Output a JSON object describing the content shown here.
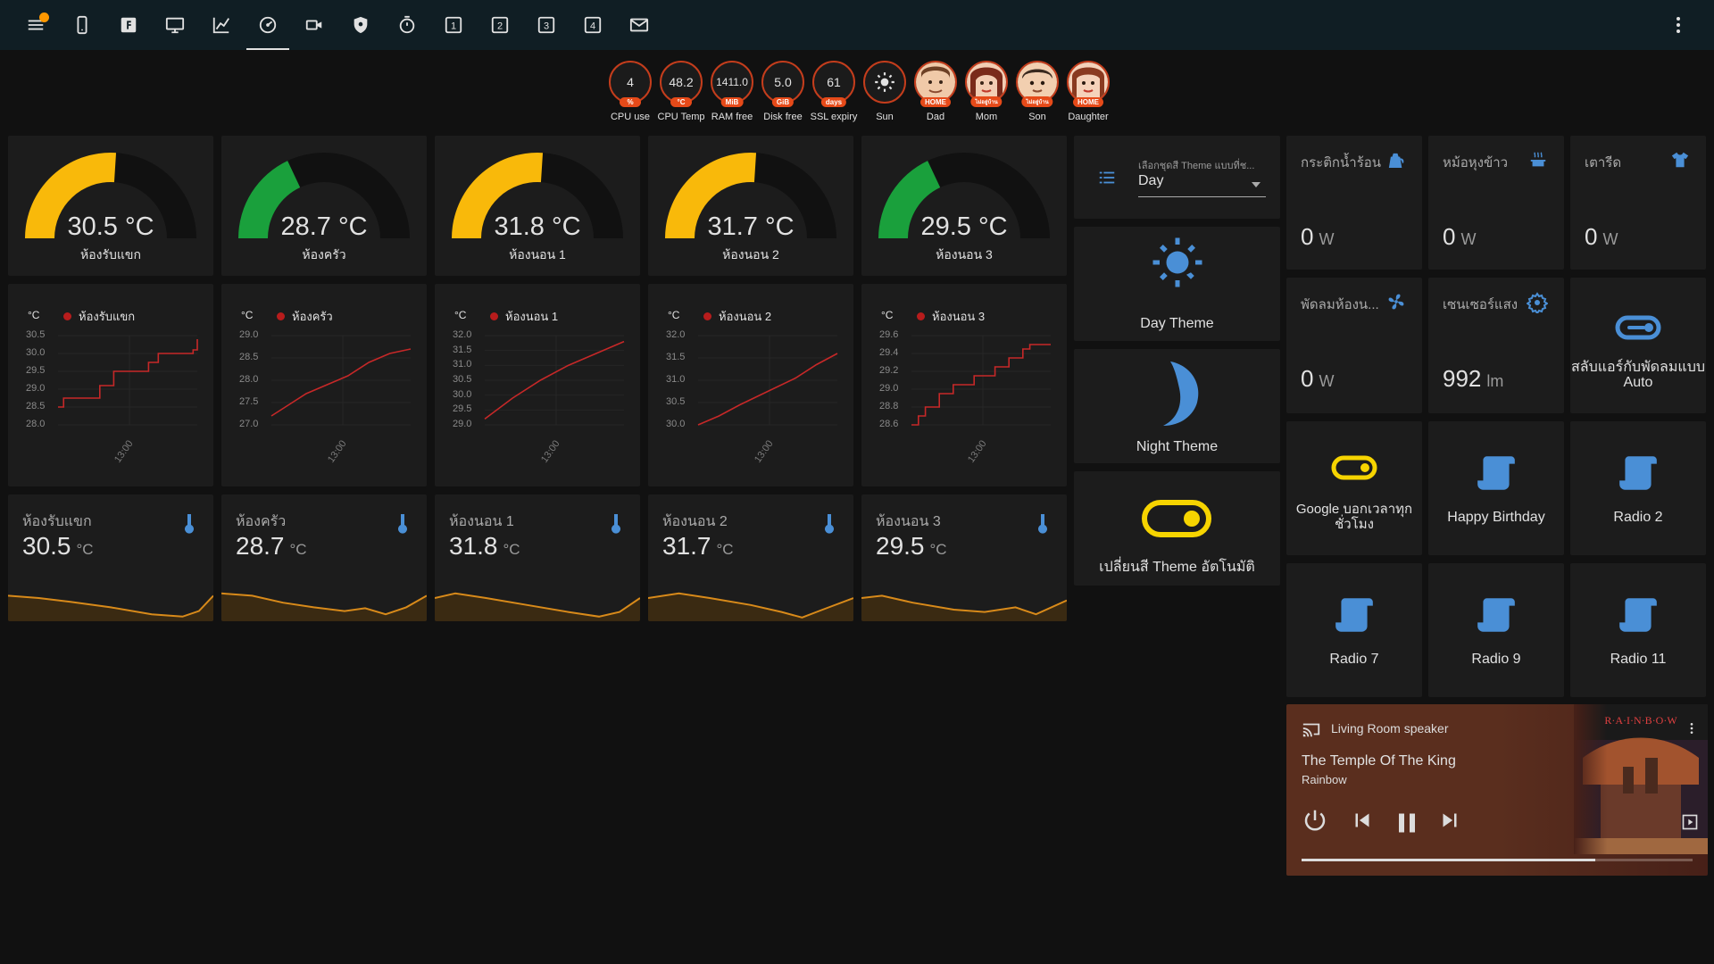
{
  "badges": [
    {
      "value": "4",
      "unit": "%",
      "label": "CPU use"
    },
    {
      "value": "48.2",
      "unit": "°C",
      "label": "CPU Temp"
    },
    {
      "value": "1411.0",
      "unit": "MiB",
      "label": "RAM free"
    },
    {
      "value": "5.0",
      "unit": "GiB",
      "label": "Disk free"
    },
    {
      "value": "61",
      "unit": "days",
      "label": "SSL expiry"
    }
  ],
  "sun": {
    "label": "Sun"
  },
  "people": [
    {
      "status": "HOME",
      "label": "Dad"
    },
    {
      "status": "ไม่อยู่บ้าน",
      "label": "Mom"
    },
    {
      "status": "ไม่อยู่บ้าน",
      "label": "Son"
    },
    {
      "status": "HOME",
      "label": "Daughter"
    }
  ],
  "colors": {
    "gauge_yellow": "#f9b90a",
    "gauge_green": "#1aa03c",
    "history_line": "#c62828",
    "sensor_line": "#d88a1a",
    "icon_blue": "#4a8fd6"
  },
  "gauges": [
    {
      "value": "30.5 °C",
      "name": "ห้องรับแขก",
      "level": 0.52,
      "color": "#f9b90a"
    },
    {
      "value": "28.7 °C",
      "name": "ห้องครัว",
      "level": 0.36,
      "color": "#1aa03c"
    },
    {
      "value": "31.8 °C",
      "name": "ห้องนอน 1",
      "level": 0.52,
      "color": "#f9b90a"
    },
    {
      "value": "31.7 °C",
      "name": "ห้องนอน 2",
      "level": 0.52,
      "color": "#f9b90a"
    },
    {
      "value": "29.5 °C",
      "name": "ห้องนอน 3",
      "level": 0.36,
      "color": "#1aa03c"
    }
  ],
  "history": [
    {
      "unit": "°C",
      "name": "ห้องรับแขก",
      "ticks": [
        "30.5",
        "30.0",
        "29.5",
        "29.0",
        "28.5",
        "28.0"
      ],
      "time": "13:00",
      "min": 28.0,
      "max": 30.5,
      "points": [
        [
          0,
          28.5
        ],
        [
          0.04,
          28.5
        ],
        [
          0.04,
          28.75
        ],
        [
          0.3,
          28.75
        ],
        [
          0.3,
          29.1
        ],
        [
          0.4,
          29.1
        ],
        [
          0.4,
          29.5
        ],
        [
          0.65,
          29.5
        ],
        [
          0.65,
          29.75
        ],
        [
          0.72,
          29.75
        ],
        [
          0.72,
          30.0
        ],
        [
          0.97,
          30.0
        ],
        [
          0.97,
          30.1
        ],
        [
          1.0,
          30.1
        ],
        [
          1.0,
          30.4
        ]
      ]
    },
    {
      "unit": "°C",
      "name": "ห้องครัว",
      "ticks": [
        "29.0",
        "28.5",
        "28.0",
        "27.5",
        "27.0"
      ],
      "time": "13:00",
      "min": 27.0,
      "max": 29.0,
      "points": [
        [
          0,
          27.2
        ],
        [
          0.1,
          27.4
        ],
        [
          0.25,
          27.7
        ],
        [
          0.4,
          27.9
        ],
        [
          0.55,
          28.1
        ],
        [
          0.7,
          28.4
        ],
        [
          0.85,
          28.6
        ],
        [
          1.0,
          28.7
        ]
      ]
    },
    {
      "unit": "°C",
      "name": "ห้องนอน 1",
      "ticks": [
        "32.0",
        "31.5",
        "31.0",
        "30.5",
        "30.0",
        "29.5",
        "29.0"
      ],
      "time": "13:00",
      "min": 29.0,
      "max": 32.0,
      "points": [
        [
          0,
          29.2
        ],
        [
          0.2,
          29.9
        ],
        [
          0.4,
          30.5
        ],
        [
          0.6,
          31.0
        ],
        [
          0.8,
          31.4
        ],
        [
          1.0,
          31.8
        ]
      ]
    },
    {
      "unit": "°C",
      "name": "ห้องนอน 2",
      "ticks": [
        "32.0",
        "31.5",
        "31.0",
        "30.5",
        "30.0"
      ],
      "time": "13:00",
      "min": 30.0,
      "max": 32.0,
      "points": [
        [
          0,
          30.0
        ],
        [
          0.15,
          30.2
        ],
        [
          0.3,
          30.45
        ],
        [
          0.5,
          30.75
        ],
        [
          0.7,
          31.05
        ],
        [
          0.85,
          31.35
        ],
        [
          1.0,
          31.6
        ]
      ]
    },
    {
      "unit": "°C",
      "name": "ห้องนอน 3",
      "ticks": [
        "29.6",
        "29.4",
        "29.2",
        "29.0",
        "28.8",
        "28.6"
      ],
      "time": "13:00",
      "min": 28.6,
      "max": 29.6,
      "points": [
        [
          0,
          28.6
        ],
        [
          0.05,
          28.6
        ],
        [
          0.05,
          28.7
        ],
        [
          0.1,
          28.7
        ],
        [
          0.1,
          28.8
        ],
        [
          0.2,
          28.8
        ],
        [
          0.2,
          28.95
        ],
        [
          0.3,
          28.95
        ],
        [
          0.3,
          29.05
        ],
        [
          0.45,
          29.05
        ],
        [
          0.45,
          29.15
        ],
        [
          0.6,
          29.15
        ],
        [
          0.6,
          29.25
        ],
        [
          0.7,
          29.25
        ],
        [
          0.7,
          29.35
        ],
        [
          0.8,
          29.35
        ],
        [
          0.8,
          29.45
        ],
        [
          0.85,
          29.45
        ],
        [
          0.85,
          29.5
        ],
        [
          1.0,
          29.5
        ]
      ]
    }
  ],
  "sensors": [
    {
      "name": "ห้องรับแขก",
      "value": "30.5",
      "unit": "°C"
    },
    {
      "name": "ห้องครัว",
      "value": "28.7",
      "unit": "°C"
    },
    {
      "name": "ห้องนอน 1",
      "value": "31.8",
      "unit": "°C"
    },
    {
      "name": "ห้องนอน 2",
      "value": "31.7",
      "unit": "°C"
    },
    {
      "name": "ห้องนอน 3",
      "value": "29.5",
      "unit": "°C"
    }
  ],
  "theme_select": {
    "label": "เลือกชุดสี Theme แบบที่ช...",
    "value": "Day"
  },
  "theme_buttons": {
    "day": "Day Theme",
    "night": "Night Theme",
    "auto": "เปลี่ยนสี Theme อัตโนมัติ"
  },
  "entities": [
    {
      "name": "กระติกน้ำร้อน",
      "value": "0",
      "unit": "W"
    },
    {
      "name": "หม้อหุงข้าว",
      "value": "0",
      "unit": "W"
    },
    {
      "name": "เตารีด",
      "value": "0",
      "unit": "W"
    },
    {
      "name": "พัดลมห้องน...",
      "value": "0",
      "unit": "W"
    },
    {
      "name": "เซนเซอร์แสง",
      "value": "992",
      "unit": "lm"
    }
  ],
  "toggle_auto": {
    "label": "สลับแอร์กับพัดลมแบบ Auto"
  },
  "scripts": [
    {
      "label": "Google บอกเวลาทุกชั่วโมง"
    },
    {
      "label": "Happy Birthday"
    },
    {
      "label": "Radio 2"
    },
    {
      "label": "Radio 7"
    },
    {
      "label": "Radio 9"
    },
    {
      "label": "Radio 11"
    }
  ],
  "media": {
    "source": "Living Room speaker",
    "title": "The Temple Of The King",
    "artist": "Rainbow",
    "progress": 0.75
  }
}
